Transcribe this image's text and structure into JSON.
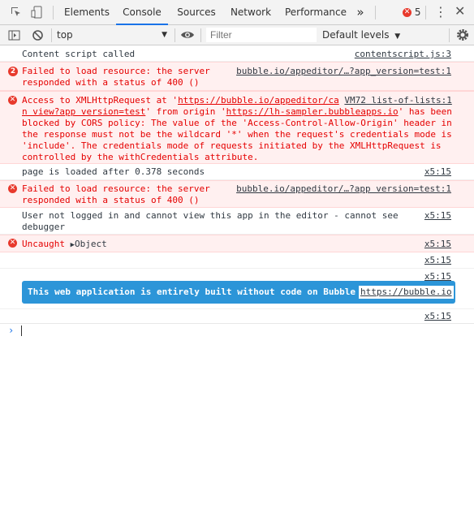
{
  "tabs": [
    "Elements",
    "Console",
    "Sources",
    "Network",
    "Performance"
  ],
  "more_tabs": "»",
  "error_count": "5",
  "toolbar": {
    "context": "top",
    "filter_placeholder": "Filter",
    "levels": "Default levels"
  },
  "messages": [
    {
      "text": "Content script called",
      "source": "contentscript.js:3"
    },
    {
      "badge": "2",
      "text": "Failed to load resource: the server\nresponded with a status of 400 ()",
      "source": "bubble.io/appeditor/…?app_version=test:1"
    },
    {
      "text_parts": [
        "Access to XMLHttpRequest at '",
        "https://bubble.io/appeditor/ca",
        " ",
        "VM72 list-of-lists:1",
        "\n",
        "n view?app version=test",
        "' from origin '",
        "https://lh-sampler.bubbleapps.io",
        "' has been\nblocked by CORS policy: The value of the 'Access-Control-Allow-Origin' header in\nthe response must not be the wildcard '*' when the request's credentials mode is\n'include'. The credentials mode of requests initiated by the XMLHttpRequest is\ncontrolled by the withCredentials attribute."
      ]
    },
    {
      "text": "page is loaded after 0.378 seconds",
      "source": "x5:15"
    },
    {
      "text": "Failed to load resource: the server\nresponded with a status of 400 ()",
      "source": "bubble.io/appeditor/…?app version=test:1"
    },
    {
      "text": "User not logged in and cannot view this app in the editor - cannot see\ndebugger",
      "source": "x5:15"
    },
    {
      "text": "Uncaught",
      "object": "Object",
      "source": "x5:15"
    },
    {
      "source": "x5:15"
    },
    {
      "source": "x5:15"
    },
    {
      "source": "x5:15"
    }
  ],
  "banner": {
    "text": "This web application is entirely built without code on Bubble",
    "link": "https://bubble.io"
  },
  "prompt": "›",
  "colors": {
    "accent": "#1a73e8",
    "error": "#e50000",
    "banner": "#2c95d8"
  }
}
